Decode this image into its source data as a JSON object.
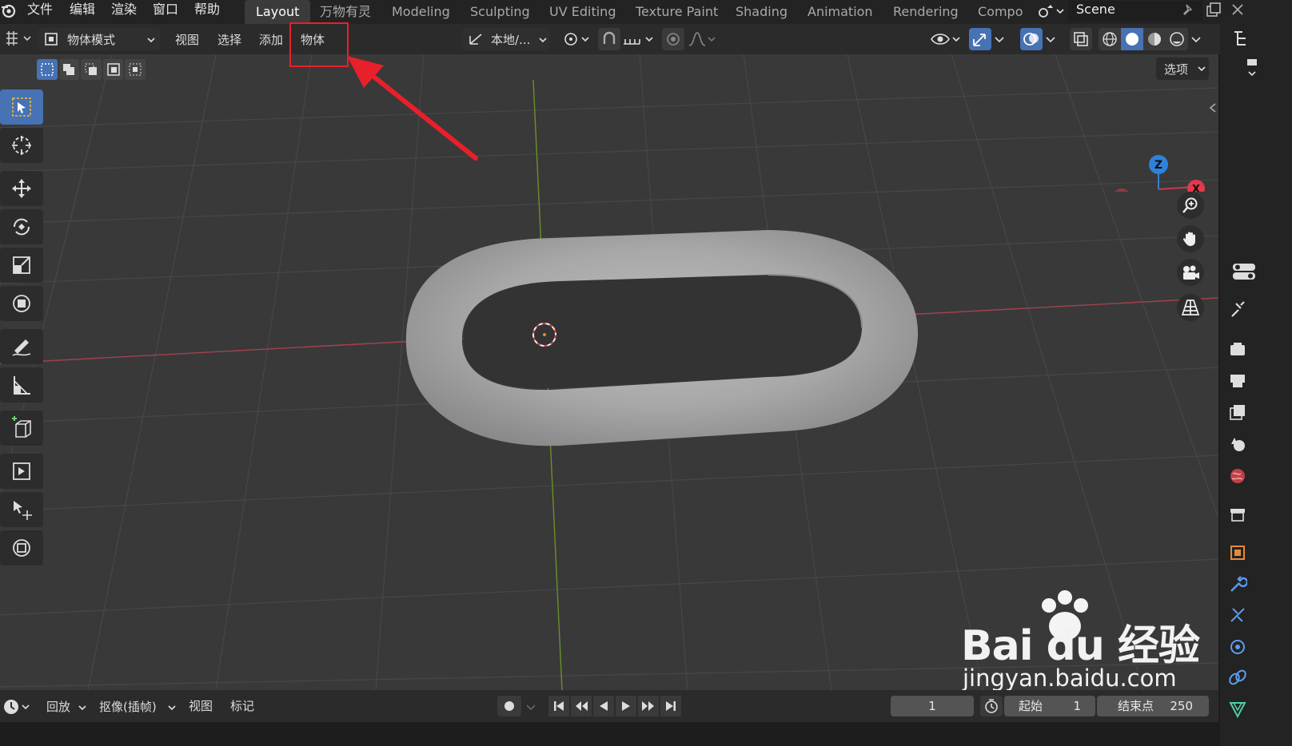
{
  "topbar": {
    "menus": [
      "文件",
      "编辑",
      "渲染",
      "窗口",
      "帮助"
    ],
    "workspace_tabs": [
      "Layout",
      "万物有灵",
      "Modeling",
      "Sculpting",
      "UV Editing",
      "Texture Paint",
      "Shading",
      "Animation",
      "Rendering",
      "Compo"
    ],
    "active_tab": "Layout",
    "scene_name": "Scene"
  },
  "header": {
    "mode_label": "物体模式",
    "menus": [
      "视图",
      "选择",
      "添加",
      "物体"
    ],
    "highlighted_menu": "物体",
    "transform_orientation": "本地/...",
    "options_label": "选项"
  },
  "timeline": {
    "playback_label": "回放",
    "keying_label": "抠像(插帧)",
    "view_label": "视图",
    "marker_label": "标记",
    "current_frame": "1",
    "start_label": "起始",
    "start_value": "1",
    "end_label": "结束点",
    "end_value": "250"
  },
  "gizmo": {
    "z_label": "Z",
    "x_label": "X"
  },
  "watermark": {
    "brand": "Bai du 经验",
    "url": "jingyan.baidu.com"
  },
  "colors": {
    "accent_blue": "#4772b3",
    "annotation_red": "#e8202a",
    "axis_x": "#c43c4b",
    "axis_y": "#6f9b21",
    "axis_z": "#2f82d9"
  }
}
